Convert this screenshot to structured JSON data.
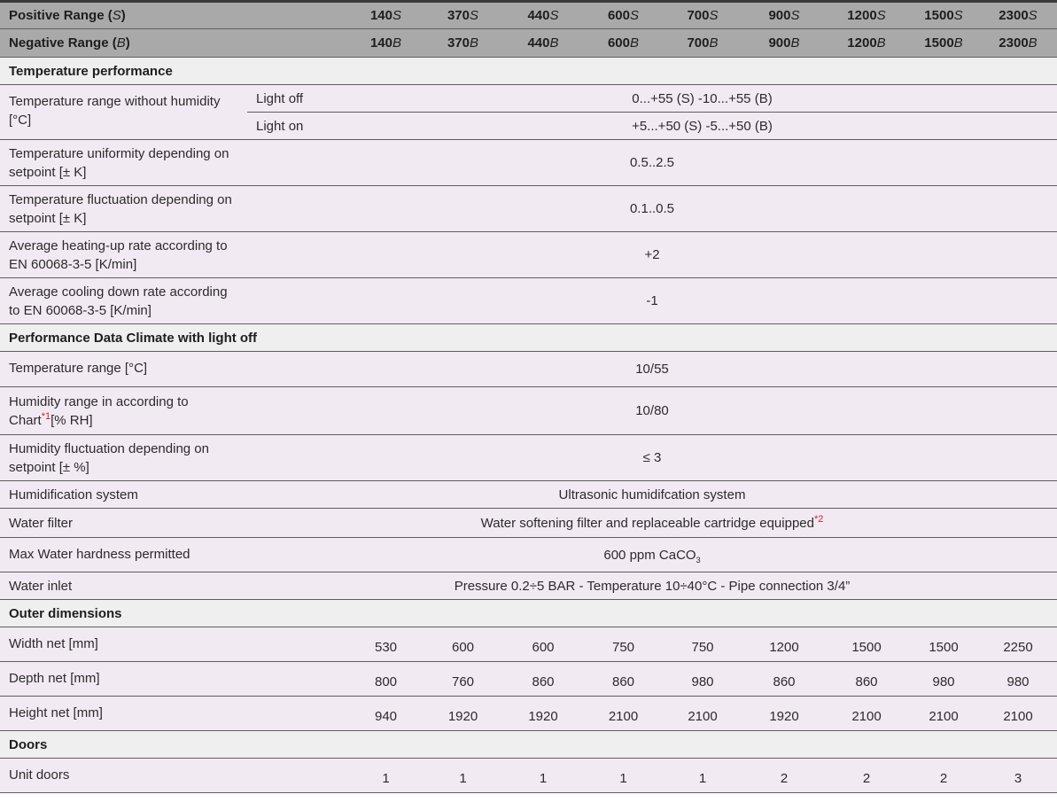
{
  "header": {
    "positive": {
      "label": "Positive Range (",
      "letter": "S",
      "close": ")",
      "models": [
        [
          "140",
          "S"
        ],
        [
          "370",
          "S"
        ],
        [
          "440",
          "S"
        ],
        [
          "600",
          "S"
        ],
        [
          "700",
          "S"
        ],
        [
          "900",
          "S"
        ],
        [
          "1200",
          "S"
        ],
        [
          "1500",
          "S"
        ],
        [
          "2300",
          "S"
        ]
      ]
    },
    "negative": {
      "label": "Negative Range (",
      "letter": "B",
      "close": ")",
      "models": [
        [
          "140",
          "B"
        ],
        [
          "370",
          "B"
        ],
        [
          "440",
          "B"
        ],
        [
          "600",
          "B"
        ],
        [
          "700",
          "B"
        ],
        [
          "900",
          "B"
        ],
        [
          "1200",
          "B"
        ],
        [
          "1500",
          "B"
        ],
        [
          "2300",
          "B"
        ]
      ]
    }
  },
  "sections": {
    "temp_perf": "Temperature performance",
    "climate": "Performance Data Climate with light off",
    "outer": "Outer dimensions",
    "doors": "Doors"
  },
  "rows": {
    "temp_range_label": "Temperature range without humidity [°C]",
    "light_off": "Light off",
    "light_off_val": "0...+55 (S) -10...+55 (B)",
    "light_on": "Light on",
    "light_on_val": "+5...+50 (S) -5...+50 (B)",
    "uniformity_label": "Temperature uniformity depending on setpoint  [± K]",
    "uniformity_val": "0.5..2.5",
    "fluctuation_label": "Temperature fluctuation depending on setpoint [± K]",
    "fluctuation_val": "0.1..0.5",
    "heating_label": "Average heating-up rate according to EN 60068-3-5 [K/min]",
    "heating_val": "+2",
    "cooling_label": "Average cooling down rate according to EN 60068-3-5 [K/min]",
    "cooling_val": "-1",
    "clim_range_label": "Temperature range [°C]",
    "clim_range_val": "10/55",
    "humidity_label_a": "Humidity range in according to Chart",
    "humidity_note": "*1",
    "humidity_label_b": "[% RH]",
    "humidity_val": "10/80",
    "hum_fluct_label": "Humidity fluctuation depending on setpoint [± %]",
    "hum_fluct_val": "≤ 3",
    "humid_sys_label": "Humidification system",
    "humid_sys_val": "Ultrasonic humidifcation system",
    "filter_label": "Water filter",
    "filter_val": "Water softening filter and replaceable cartridge equipped",
    "filter_note": "*2",
    "hardness_label": "Max Water hardness permitted",
    "hardness_val": "600 ppm CaCO",
    "hardness_sub": "3",
    "inlet_label": "Water inlet",
    "inlet_val": "Pressure 0.2÷5 BAR  - Temperature 10÷40°C - Pipe connection 3/4”",
    "width_label": "Width net [mm]",
    "width": [
      "530",
      "600",
      "600",
      "750",
      "750",
      "1200",
      "1500",
      "1500",
      "2250"
    ],
    "depth_label": "Depth net [mm]",
    "depth": [
      "800",
      "760",
      "860",
      "860",
      "980",
      "860",
      "860",
      "980",
      "980"
    ],
    "height_label": "Height net [mm]",
    "height": [
      "940",
      "1920",
      "1920",
      "2100",
      "2100",
      "1920",
      "2100",
      "2100",
      "2100"
    ],
    "doors_label": "Unit doors",
    "doors": [
      "1",
      "1",
      "1",
      "1",
      "1",
      "2",
      "2",
      "2",
      "3"
    ]
  }
}
